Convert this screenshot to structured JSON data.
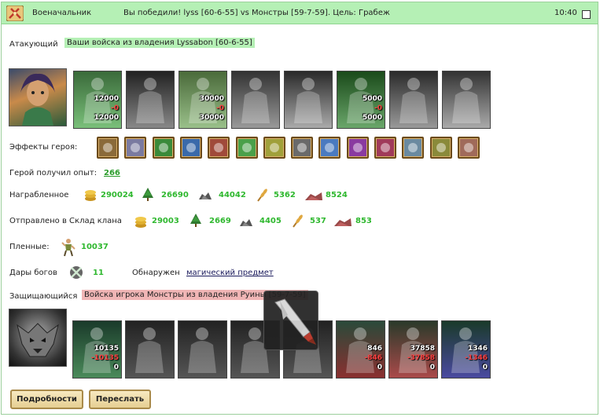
{
  "header": {
    "category": "Военачальник",
    "message": "Вы победили! lyss [60-6-55] vs Монстры [59-7-59]. Цель: Грабеж",
    "time": "10:40"
  },
  "attacker": {
    "label": "Атакующий",
    "army": "Ваши войска из владения Lyssabon [60-6-55]",
    "units": [
      {
        "count": "12000",
        "loss": "-0",
        "total": "12000"
      },
      {
        "count": "",
        "loss": "",
        "total": ""
      },
      {
        "count": "30000",
        "loss": "-0",
        "total": "30000"
      },
      {
        "count": "",
        "loss": "",
        "total": ""
      },
      {
        "count": "",
        "loss": "",
        "total": ""
      },
      {
        "count": "5000",
        "loss": "-0",
        "total": "5000"
      },
      {
        "count": "",
        "loss": "",
        "total": ""
      },
      {
        "count": "",
        "loss": "",
        "total": ""
      }
    ]
  },
  "hero_effects": {
    "label": "Эффекты героя:",
    "icons": [
      "skull-icon",
      "tower-icon",
      "staff-icon",
      "frost-icon",
      "sword-icon",
      "potion-icon",
      "rocket-icon",
      "wolf-icon",
      "question-icon",
      "demon-icon",
      "claw-icon",
      "blade-icon",
      "spear-icon",
      "shield-icon"
    ]
  },
  "experience": {
    "label": "Герой получил опыт:",
    "value": "266"
  },
  "plunder": {
    "label": "Награбленное",
    "gold": "290024",
    "wood": "26690",
    "ore": "44042",
    "grain": "5362",
    "stone": "8524"
  },
  "clan": {
    "label": "Отправлено в Склад клана",
    "gold": "29003",
    "wood": "2669",
    "ore": "4405",
    "grain": "537",
    "stone": "853"
  },
  "prisoners": {
    "label": "Пленные:",
    "value": "10037"
  },
  "gifts": {
    "label": "Дары богов",
    "value": "11",
    "found_label": "Обнаружен",
    "found_item": "магический предмет"
  },
  "defender": {
    "label": "Защищающийся",
    "army": "Войска игрока Монстры из владения Руины [59-7-59]",
    "units": [
      {
        "count": "10135",
        "loss": "-10135",
        "total": "0"
      },
      {
        "count": "",
        "loss": "",
        "total": ""
      },
      {
        "count": "",
        "loss": "",
        "total": ""
      },
      {
        "count": "",
        "loss": "",
        "total": ""
      },
      {
        "count": "",
        "loss": "",
        "total": ""
      },
      {
        "count": "846",
        "loss": "-846",
        "total": "0"
      },
      {
        "count": "37858",
        "loss": "-37858",
        "total": "0"
      },
      {
        "count": "1346",
        "loss": "-1346",
        "total": "0"
      }
    ]
  },
  "buttons": {
    "details": "Подробности",
    "forward": "Переслать"
  },
  "colors": {
    "header_bg": "#b5f0b5",
    "accent_green": "#2fb82f",
    "loss_red": "#ff4040",
    "defender_tag": "#f0b5b5"
  }
}
